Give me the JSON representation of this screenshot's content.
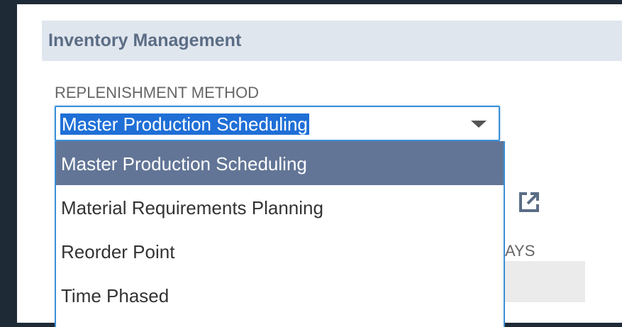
{
  "section": {
    "title": "Inventory Management"
  },
  "replenishment": {
    "label": "REPLENISHMENT METHOD",
    "selected_value": "Master Production Scheduling",
    "options": [
      {
        "label": "Master Production Scheduling",
        "selected": true
      },
      {
        "label": "Material Requirements Planning",
        "selected": false
      },
      {
        "label": "Reorder Point",
        "selected": false
      },
      {
        "label": "Time Phased",
        "selected": false
      }
    ]
  },
  "background_field": {
    "partial_label": "AYS"
  },
  "colors": {
    "page_background": "#1e2a36",
    "header_background": "#e0e6ee",
    "header_text": "#5b6d85",
    "focus_border": "#3a8fd8",
    "text_highlight": "#1f6fd6",
    "selected_option": "#627596"
  },
  "icons": {
    "dropdown_caret": "caret-down-icon",
    "external_link": "external-link-icon"
  }
}
